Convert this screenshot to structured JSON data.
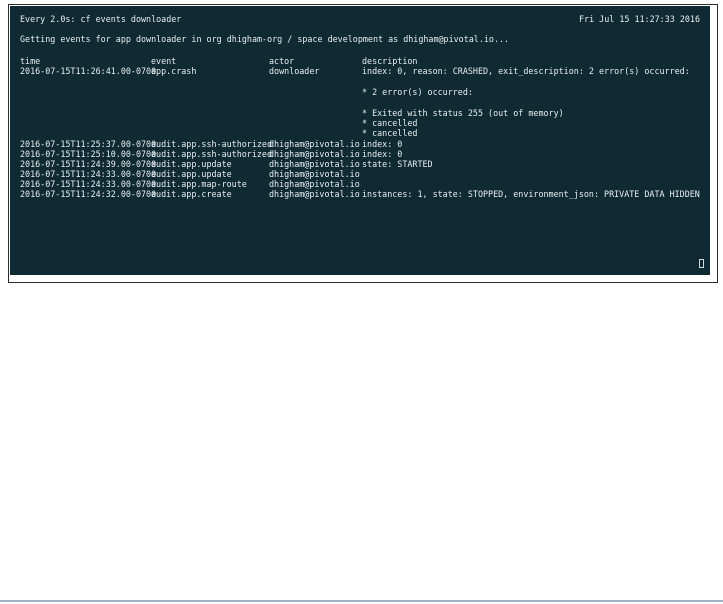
{
  "watch": {
    "command": "Every 2.0s: cf events downloader",
    "datetime": "Fri Jul 15 11:27:33 2016"
  },
  "info": "Getting events for app downloader in org dhigham-org / space development as dhigham@pivotal.io...",
  "headers": {
    "time": "time",
    "event": "event",
    "actor": "actor",
    "description": "description"
  },
  "crash": {
    "time": "2016-07-15T11:26:41.00-0700",
    "event": "app.crash",
    "actor": "downloader",
    "description": "index: 0, reason: CRASHED, exit_description: 2 error(s) occurred:",
    "details": [
      "* 2 error(s) occurred:",
      "* Exited with status 255 (out of memory)",
      "* cancelled",
      "* cancelled"
    ]
  },
  "rows": [
    {
      "time": "2016-07-15T11:25:37.00-0700",
      "event": "audit.app.ssh-authorized",
      "actor": "dhigham@pivotal.io",
      "description": "index: 0"
    },
    {
      "time": "2016-07-15T11:25:10.00-0700",
      "event": "audit.app.ssh-authorized",
      "actor": "dhigham@pivotal.io",
      "description": "index: 0"
    },
    {
      "time": "2016-07-15T11:24:39.00-0700",
      "event": "audit.app.update",
      "actor": "dhigham@pivotal.io",
      "description": "state: STARTED"
    },
    {
      "time": "2016-07-15T11:24:33.00-0700",
      "event": "audit.app.update",
      "actor": "dhigham@pivotal.io",
      "description": ""
    },
    {
      "time": "2016-07-15T11:24:33.00-0700",
      "event": "audit.app.map-route",
      "actor": "dhigham@pivotal.io",
      "description": ""
    },
    {
      "time": "2016-07-15T11:24:32.00-0700",
      "event": "audit.app.create",
      "actor": "dhigham@pivotal.io",
      "description": "instances: 1, state: STOPPED, environment_json: PRIVATE DATA HIDDEN"
    }
  ]
}
